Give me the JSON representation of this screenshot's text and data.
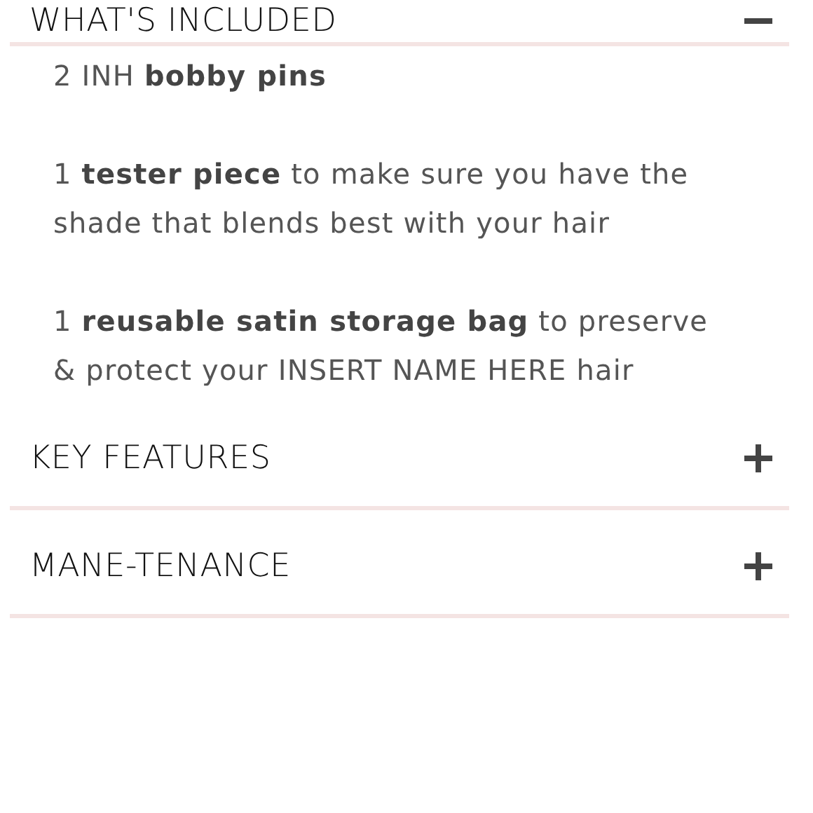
{
  "sections": [
    {
      "title": "WHAT'S INCLUDED",
      "expanded": true,
      "items": [
        "2 INH **bobby pins**",
        "1 **tester piece** to make sure you have the shade that blends best with your hair",
        "1 **reusable satin storage bag** to preserve & protect your INSERT NAME HERE hair"
      ]
    },
    {
      "title": "KEY FEATURES",
      "expanded": false
    },
    {
      "title": "MANE-TENANCE",
      "expanded": false
    }
  ]
}
